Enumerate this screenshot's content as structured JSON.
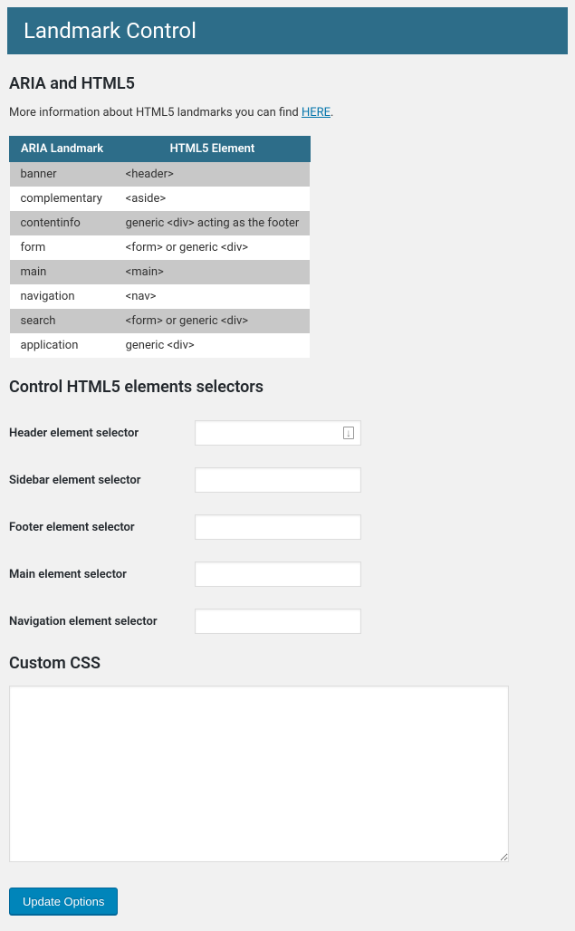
{
  "header": {
    "title": "Landmark Control"
  },
  "section_aria": {
    "heading": "ARIA and HTML5",
    "info_prefix": "More information about HTML5 landmarks you can find ",
    "info_link": "HERE",
    "info_suffix": "."
  },
  "table": {
    "col1_header": "ARIA Landmark",
    "col2_header": "HTML5 Element",
    "rows": [
      {
        "aria": "banner",
        "html5": "<header>"
      },
      {
        "aria": "complementary",
        "html5": "<aside>"
      },
      {
        "aria": "contentinfo",
        "html5": "generic <div> acting as the footer"
      },
      {
        "aria": "form",
        "html5": "<form> or generic <div>"
      },
      {
        "aria": "main",
        "html5": "<main>"
      },
      {
        "aria": "navigation",
        "html5": "<nav>"
      },
      {
        "aria": "search",
        "html5": "<form> or generic <div>"
      },
      {
        "aria": "application",
        "html5": "generic <div>"
      }
    ]
  },
  "section_selectors": {
    "heading": "Control HTML5 elements selectors",
    "fields": [
      {
        "label": "Header element selector",
        "value": "",
        "has_icon": true
      },
      {
        "label": "Sidebar element selector",
        "value": "",
        "has_icon": false
      },
      {
        "label": "Footer element selector",
        "value": "",
        "has_icon": false
      },
      {
        "label": "Main element selector",
        "value": "",
        "has_icon": false
      },
      {
        "label": "Navigation element selector",
        "value": "",
        "has_icon": false
      }
    ]
  },
  "section_css": {
    "heading": "Custom CSS",
    "value": ""
  },
  "submit": {
    "label": "Update Options"
  }
}
